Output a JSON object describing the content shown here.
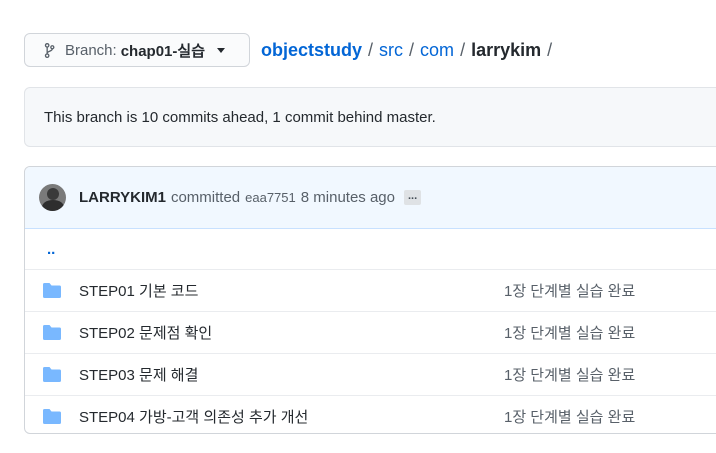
{
  "branch": {
    "prefix": "Branch:",
    "name": "chap01-실습"
  },
  "breadcrumb": {
    "repo": "objectstudy",
    "path1": "src",
    "path2": "com",
    "current": "larrykim",
    "sep": "/"
  },
  "ahead": {
    "text": "This branch is 10 commits ahead, 1 commit behind master."
  },
  "commit": {
    "author": "LARRYKIM1",
    "verb": "committed",
    "sha": "eaa7751",
    "ago": "8 minutes ago",
    "more": "..."
  },
  "files": {
    "parent": "..",
    "rows": [
      {
        "name": "STEP01 기본 코드",
        "message": "1장 단계별 실습 완료"
      },
      {
        "name": "STEP02 문제점 확인",
        "message": "1장 단계별 실습 완료"
      },
      {
        "name": "STEP03 문제 해결",
        "message": "1장 단계별 실습 완료"
      },
      {
        "name": "STEP04 가방-고객 의존성 추가 개선",
        "message": "1장 단계별 실습 완료"
      }
    ],
    "folder_icon": "folder-icon",
    "folder_color": "#79b8ff"
  },
  "colors": {
    "link": "#0366d6",
    "commit_bg": "#f1f8ff",
    "box_bg": "#f6f8fa"
  }
}
